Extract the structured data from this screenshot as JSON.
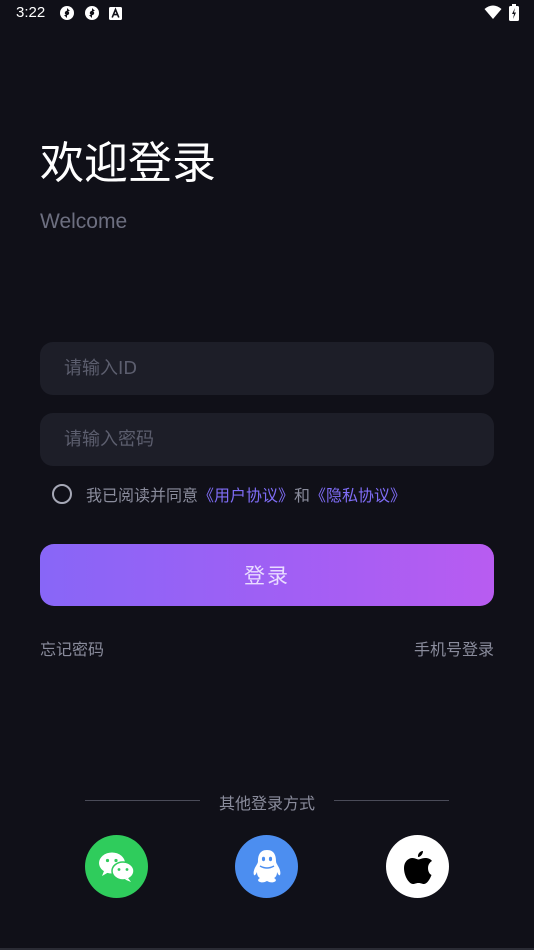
{
  "status_bar": {
    "time": "3:22",
    "icons": [
      "sync-icon",
      "sync-icon",
      "notification-a-icon"
    ],
    "right_icons": [
      "wifi-icon",
      "battery-icon"
    ]
  },
  "header": {
    "title": "欢迎登录",
    "subtitle": "Welcome"
  },
  "form": {
    "id_placeholder": "请输入ID",
    "password_placeholder": "请输入密码",
    "agree_prefix": "我已阅读并同意",
    "user_agreement": "《用户协议》",
    "and_text": "和",
    "privacy_policy": "《隐私协议》",
    "login_label": "登录"
  },
  "links": {
    "forgot_password": "忘记密码",
    "phone_login": "手机号登录"
  },
  "other_login": {
    "label": "其他登录方式",
    "methods": [
      "wechat-icon",
      "qq-icon",
      "apple-icon"
    ]
  },
  "colors": {
    "background": "#101018",
    "field": "#1d1e28",
    "accent_start": "#8866f7",
    "accent_end": "#b85cf1",
    "link": "#7f6df6",
    "wechat": "#2fcc5c",
    "qq": "#4c8ef0",
    "apple": "#ffffff"
  }
}
